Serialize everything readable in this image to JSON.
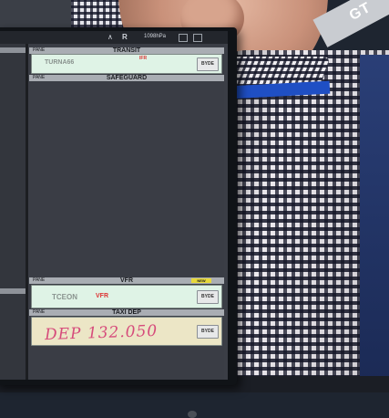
{
  "corner_tag": "GT",
  "statusbar": {
    "wifi_icon": "wifi-icon",
    "letter": "R",
    "frequency": "1098hPa"
  },
  "bays": {
    "transit": {
      "title": "TRANSIT",
      "mini": "PANE"
    },
    "safeguard": {
      "title": "SAFEGUARD",
      "mini": "PANE"
    },
    "vfr": {
      "title": "VFR",
      "mini": "PANE",
      "tag": "NEW"
    },
    "taxi_dep": {
      "title": "TAXI DEP",
      "mini": "PANE"
    }
  },
  "strips": {
    "transit_strip": {
      "callsign": "TURNA66",
      "rule": "IFR",
      "button": "BYDE"
    },
    "vfr_strip": {
      "callsign": "TCEON",
      "rule": "VFR",
      "button": "BYDE"
    },
    "taxi_strip": {
      "note": "DEP  132.050",
      "button": "BYDE"
    }
  },
  "colors": {
    "green_strip": "#dff3e6",
    "yellow_strip": "#ece6c6",
    "handwriting": "#d64b7b",
    "rule_red": "#d33333",
    "header_grey": "#a9adb3"
  }
}
